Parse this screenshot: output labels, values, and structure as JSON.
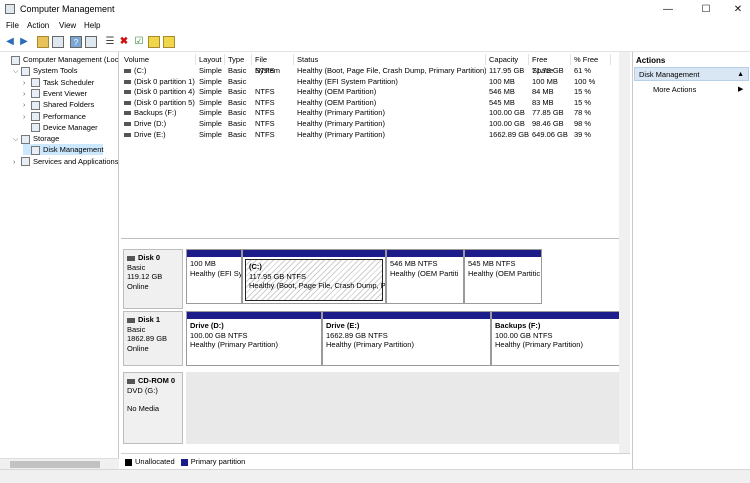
{
  "window": {
    "title": "Computer Management"
  },
  "menu": [
    "File",
    "Action",
    "View",
    "Help"
  ],
  "tree": [
    {
      "label": "Computer Management (Local",
      "indent": 0,
      "arrow": ""
    },
    {
      "label": "System Tools",
      "indent": 1,
      "arrow": "v"
    },
    {
      "label": "Task Scheduler",
      "indent": 2,
      "arrow": ">"
    },
    {
      "label": "Event Viewer",
      "indent": 2,
      "arrow": ">"
    },
    {
      "label": "Shared Folders",
      "indent": 2,
      "arrow": ">"
    },
    {
      "label": "Performance",
      "indent": 2,
      "arrow": ">"
    },
    {
      "label": "Device Manager",
      "indent": 2,
      "arrow": ""
    },
    {
      "label": "Storage",
      "indent": 1,
      "arrow": "v"
    },
    {
      "label": "Disk Management",
      "indent": 2,
      "arrow": ""
    },
    {
      "label": "Services and Applications",
      "indent": 1,
      "arrow": ">"
    }
  ],
  "columns": [
    "Volume",
    "Layout",
    "Type",
    "File System",
    "Status",
    "Capacity",
    "Free Space",
    "% Free"
  ],
  "rows": [
    [
      "(C:)",
      "Simple",
      "Basic",
      "NTFS",
      "Healthy (Boot, Page File, Crash Dump, Primary Partition)",
      "117.95 GB",
      "71.78 GB",
      "61 %"
    ],
    [
      "(Disk 0 partition 1)",
      "Simple",
      "Basic",
      "",
      "Healthy (EFI System Partition)",
      "100 MB",
      "100 MB",
      "100 %"
    ],
    [
      "(Disk 0 partition 4)",
      "Simple",
      "Basic",
      "NTFS",
      "Healthy (OEM Partition)",
      "546 MB",
      "84 MB",
      "15 %"
    ],
    [
      "(Disk 0 partition 5)",
      "Simple",
      "Basic",
      "NTFS",
      "Healthy (OEM Partition)",
      "545 MB",
      "83 MB",
      "15 %"
    ],
    [
      "Backups (F:)",
      "Simple",
      "Basic",
      "NTFS",
      "Healthy (Primary Partition)",
      "100.00 GB",
      "77.85 GB",
      "78 %"
    ],
    [
      "Drive (D:)",
      "Simple",
      "Basic",
      "NTFS",
      "Healthy (Primary Partition)",
      "100.00 GB",
      "98.46 GB",
      "98 %"
    ],
    [
      "Drive (E:)",
      "Simple",
      "Basic",
      "NTFS",
      "Healthy (Primary Partition)",
      "1662.89 GB",
      "649.06 GB",
      "39 %"
    ]
  ],
  "disks": {
    "d0": {
      "name": "Disk 0",
      "type": "Basic",
      "size": "119.12 GB",
      "state": "Online"
    },
    "d1": {
      "name": "Disk 1",
      "type": "Basic",
      "size": "1862.89 GB",
      "state": "Online"
    },
    "d2": {
      "name": "CD-ROM 0",
      "type": "DVD (G:)",
      "state": "No Media"
    }
  },
  "parts": {
    "p01": {
      "l1": "",
      "l2": "100 MB",
      "l3": "Healthy (EFI Sy"
    },
    "p02": {
      "l1": "(C:)",
      "l2": "117.95 GB NTFS",
      "l3": "Healthy (Boot, Page File, Crash Dump, Pr"
    },
    "p03": {
      "l1": "",
      "l2": "546 MB NTFS",
      "l3": "Healthy (OEM Partiti"
    },
    "p04": {
      "l1": "",
      "l2": "545 MB NTFS",
      "l3": "Healthy (OEM Partitic"
    },
    "p11": {
      "l1": "Drive  (D:)",
      "l2": "100.00 GB NTFS",
      "l3": "Healthy (Primary Partition)"
    },
    "p12": {
      "l1": "Drive  (E:)",
      "l2": "1662.89 GB NTFS",
      "l3": "Healthy (Primary Partition)"
    },
    "p13": {
      "l1": "Backups  (F:)",
      "l2": "100.00 GB NTFS",
      "l3": "Healthy (Primary Partition)"
    }
  },
  "legend": {
    "unallocated": "Unallocated",
    "primary": "Primary partition"
  },
  "actions": {
    "header": "Actions",
    "section": "Disk Management",
    "more": "More Actions"
  },
  "colors": {
    "primary": "#1c1c8a",
    "unallocated": "#000000",
    "selection": "#cce8ff"
  }
}
